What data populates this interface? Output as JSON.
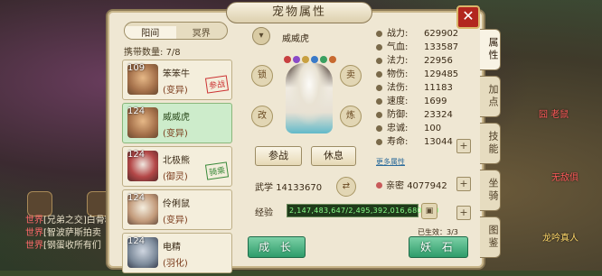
{
  "window": {
    "title": "宠物属性",
    "close_glyph": "✕"
  },
  "tabs": {
    "left": [
      "阳间",
      "冥界"
    ],
    "left_active": 0,
    "right": [
      "属性",
      "加点",
      "技能",
      "坐骑",
      "图鉴"
    ],
    "right_active": 0
  },
  "carry": {
    "label": "携带数量:",
    "value": "7/8"
  },
  "pets": [
    {
      "level": "109",
      "name": "笨笨牛",
      "type": "(变异)",
      "stamp": "参战",
      "stamp_color": "#cc3333",
      "selected": false
    },
    {
      "level": "124",
      "name": "威威虎",
      "type": "(变异)",
      "stamp": "",
      "selected": true
    },
    {
      "level": "124",
      "name": "北极熊",
      "type": "(御灵)",
      "stamp": "骑乘",
      "stamp_color": "#3a8a3a",
      "selected": false
    },
    {
      "level": "124",
      "name": "伶俐鼠",
      "type": "(变异)",
      "stamp": "",
      "selected": false
    },
    {
      "level": "124",
      "name": "电精",
      "type": "(羽化)",
      "stamp": "",
      "selected": false
    }
  ],
  "pet_detail": {
    "name": "威威虎",
    "buttons": {
      "fight": "参战",
      "rest": "休息"
    },
    "wuxue_label": "武学",
    "wuxue_value": "14133670",
    "exp_label": "经验",
    "exp_value": "2,147,483,647/2,495,392,016,680,780",
    "grow_button": "成 长",
    "stone_button": "妖 石",
    "effect": "已生效：3/3"
  },
  "stats": [
    {
      "label": "战力:",
      "value": "629902"
    },
    {
      "label": "气血:",
      "value": "133587"
    },
    {
      "label": "法力:",
      "value": "22956"
    },
    {
      "label": "物伤:",
      "value": "129485"
    },
    {
      "label": "法伤:",
      "value": "11183"
    },
    {
      "label": "速度:",
      "value": "1699"
    },
    {
      "label": "防御:",
      "value": "23324"
    },
    {
      "label": "忠诚:",
      "value": "100"
    },
    {
      "label": "寿命:",
      "value": "13044"
    }
  ],
  "more_stats": "更多属性",
  "qinmi": {
    "label": "亲密",
    "value": "4077942"
  },
  "chat": [
    {
      "channel": "世界",
      "text": "[兄弟之交]白骨精"
    },
    {
      "channel": "世界",
      "text": "[智波萨斯拍卖"
    },
    {
      "channel": "世界",
      "text": "[钢蛋收所有们"
    }
  ],
  "scene_labels": [
    "囧 老鼠",
    "无敌俱",
    "龙吟真人"
  ]
}
